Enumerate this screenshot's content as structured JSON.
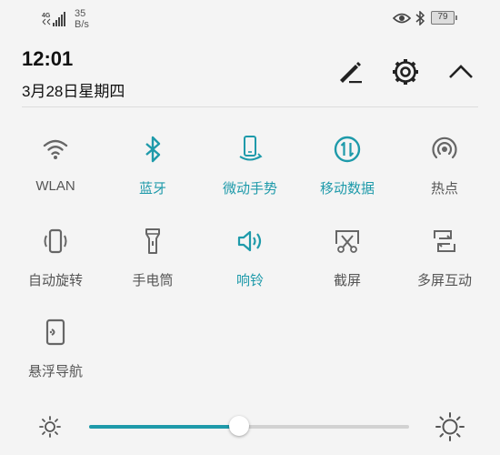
{
  "status_bar": {
    "network": "4G",
    "speed_value": "35",
    "speed_unit": "B/s",
    "battery": "79",
    "icons": [
      "signal-icon",
      "eye-icon",
      "bluetooth-icon",
      "battery-icon"
    ]
  },
  "header": {
    "time": "12:01",
    "date": "3月28日星期四",
    "icons": [
      "edit-icon",
      "settings-icon",
      "collapse-icon"
    ]
  },
  "tiles": [
    {
      "label": "WLAN",
      "icon": "wifi-icon",
      "active": false
    },
    {
      "label": "蓝牙",
      "icon": "bluetooth-icon",
      "active": true
    },
    {
      "label": "微动手势",
      "icon": "motion-gesture-icon",
      "active": true
    },
    {
      "label": "移动数据",
      "icon": "mobile-data-icon",
      "active": true
    },
    {
      "label": "热点",
      "icon": "hotspot-icon",
      "active": false
    },
    {
      "label": "自动旋转",
      "icon": "auto-rotate-icon",
      "active": false
    },
    {
      "label": "手电筒",
      "icon": "flashlight-icon",
      "active": false
    },
    {
      "label": "响铃",
      "icon": "ring-icon",
      "active": true
    },
    {
      "label": "截屏",
      "icon": "screenshot-icon",
      "active": false
    },
    {
      "label": "多屏互动",
      "icon": "multi-screen-icon",
      "active": false
    },
    {
      "label": "悬浮导航",
      "icon": "floating-dock-icon",
      "active": false
    }
  ],
  "brightness": {
    "level": 0.47,
    "icons": [
      "brightness-low-icon",
      "brightness-high-icon"
    ]
  },
  "colors": {
    "accent": "#1e9aaa",
    "inactive_icon": "#666666",
    "background": "#f4f4f4"
  }
}
